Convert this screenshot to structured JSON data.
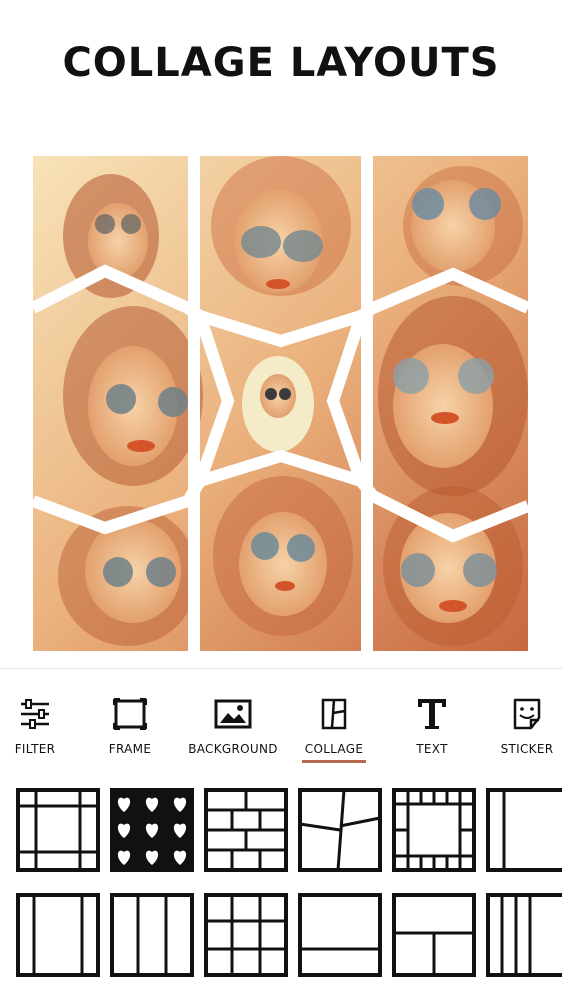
{
  "header": {
    "title": "COLLAGE LAYOUTS"
  },
  "toolbar": {
    "items": [
      {
        "label": "FILTER",
        "icon": "sliders-icon"
      },
      {
        "label": "FRAME",
        "icon": "frame-icon"
      },
      {
        "label": "BACKGROUND",
        "icon": "image-icon"
      },
      {
        "label": "COLLAGE",
        "icon": "collage-icon",
        "active": true
      },
      {
        "label": "TEXT",
        "icon": "text-icon"
      },
      {
        "label": "STICKER",
        "icon": "sticker-icon"
      }
    ],
    "accent_color": "#b66a4f"
  },
  "layouts": {
    "row1": [
      "grid-frame-layout",
      "hearts-layout",
      "brick-layout",
      "tilted-layout",
      "border-grid-layout",
      "two-panel-layout"
    ],
    "row2": [
      "three-column-layout",
      "three-column-alt-layout",
      "three-by-three-layout",
      "top-bottom-layout",
      "four-panel-layout",
      "four-column-layout"
    ]
  },
  "preview": {
    "description_color": "#f0c9a0"
  }
}
